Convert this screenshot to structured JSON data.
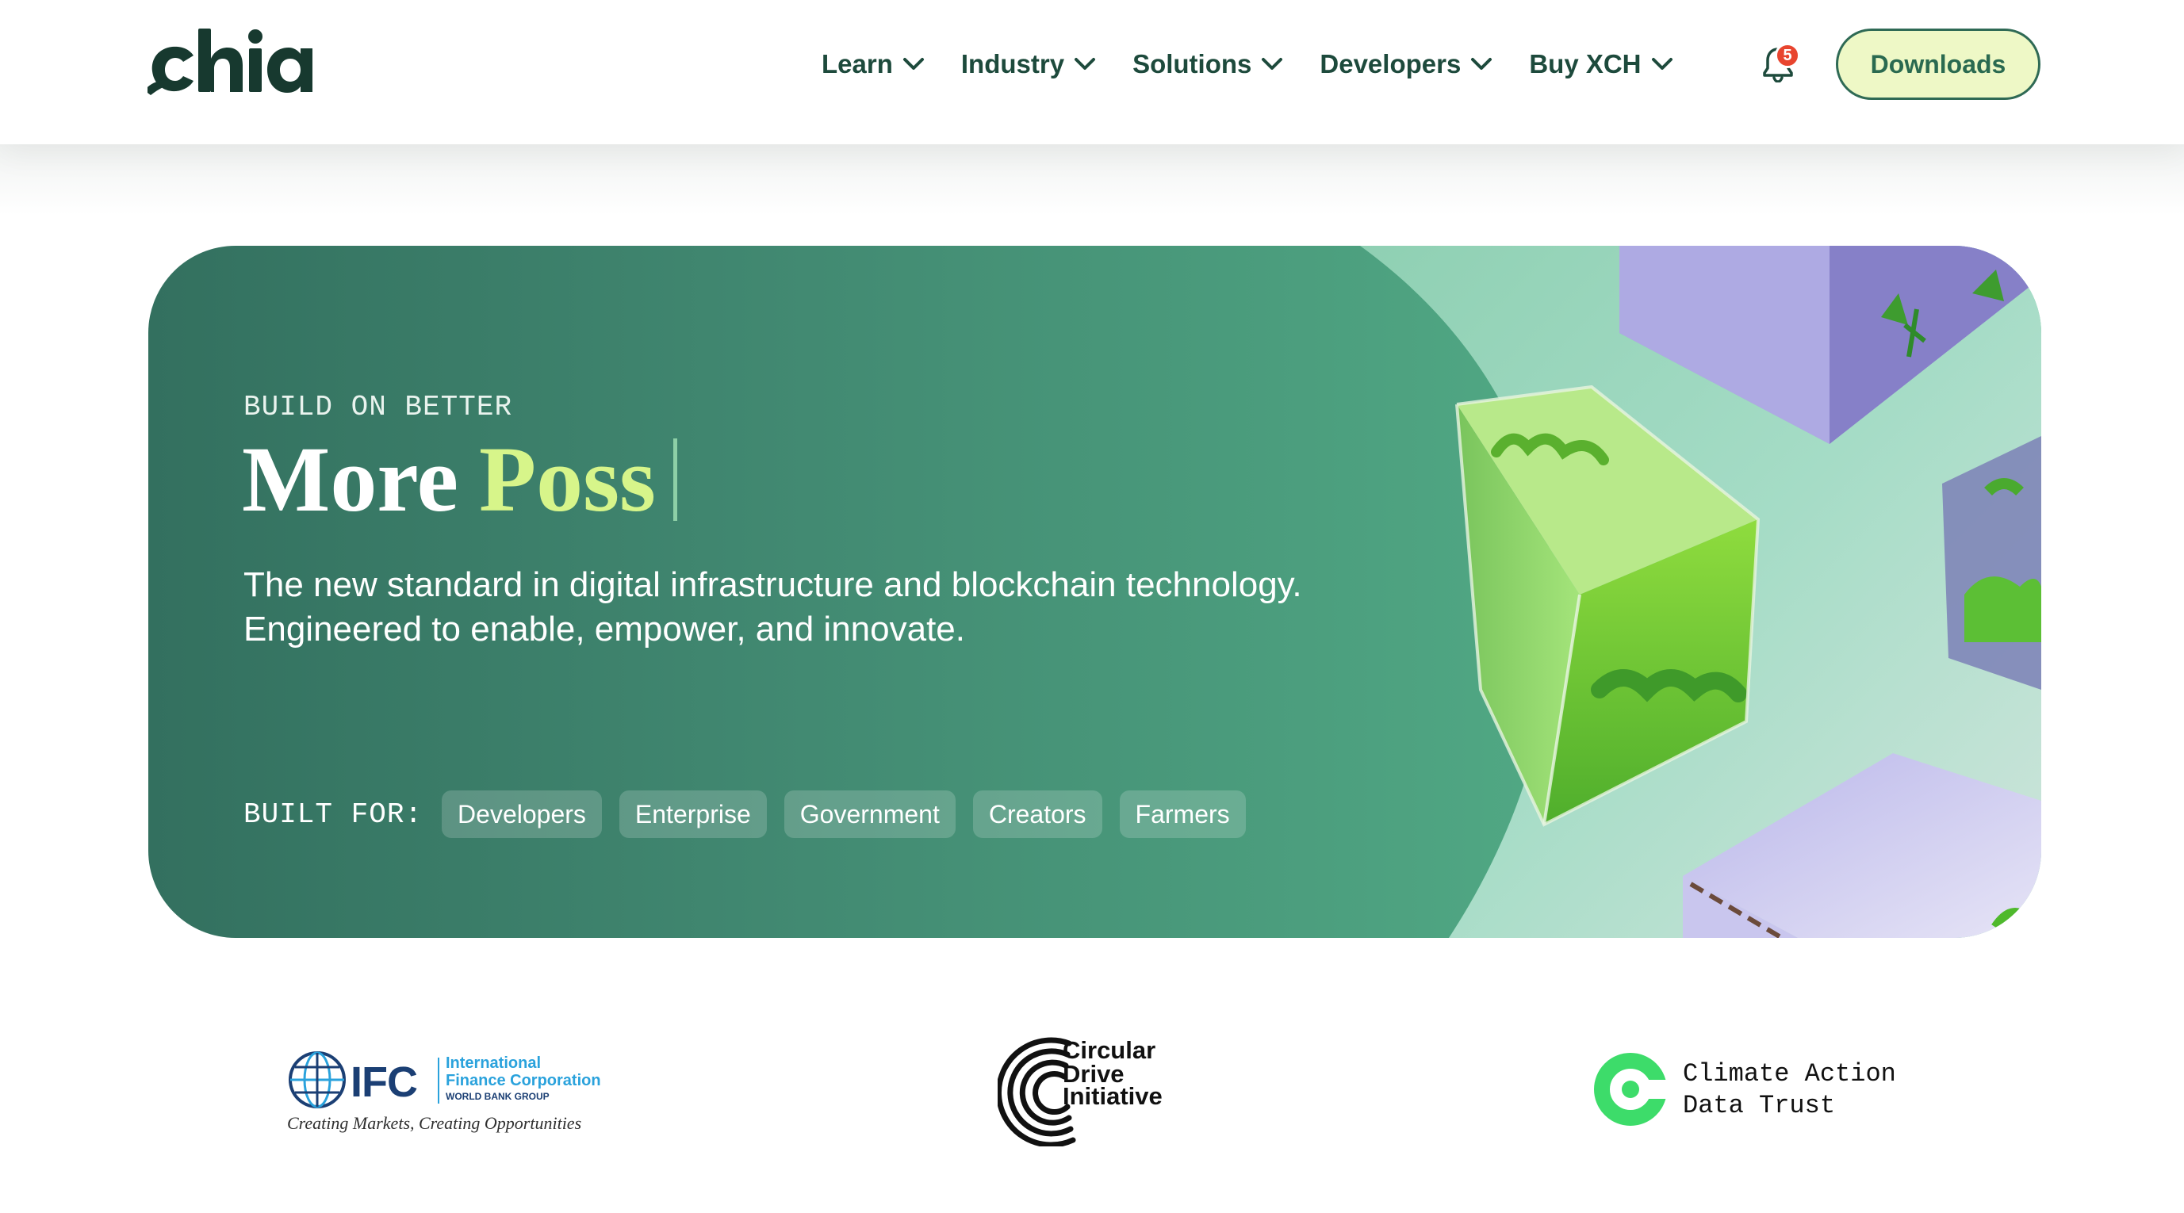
{
  "header": {
    "brand": "chia",
    "nav": [
      {
        "label": "Learn"
      },
      {
        "label": "Industry"
      },
      {
        "label": "Solutions"
      },
      {
        "label": "Developers"
      },
      {
        "label": "Buy XCH"
      }
    ],
    "notification_count": "5",
    "downloads_label": "Downloads"
  },
  "hero": {
    "eyebrow": "BUILD ON BETTER",
    "title_main": "More",
    "title_accent": "Poss",
    "subtitle_line1": "The new standard in digital infrastructure and blockchain technology.",
    "subtitle_line2": "Engineered to enable, empower, and innovate.",
    "built_for_label": "BUILT FOR:",
    "audiences": [
      "Developers",
      "Enterprise",
      "Government",
      "Creators",
      "Farmers"
    ]
  },
  "partners": {
    "ifc": {
      "abbr": "IFC",
      "name_line1": "International",
      "name_line2": "Finance Corporation",
      "name_line3": "WORLD BANK GROUP",
      "tagline": "Creating Markets, Creating Opportunities"
    },
    "cdi": {
      "line1": "Circular",
      "line2": "Drive",
      "line3": "Initiative"
    },
    "cadt": {
      "line1": "Climate Action",
      "line2": "Data Trust"
    }
  },
  "colors": {
    "brand_dark": "#1d4a3c",
    "accent_lime": "#d7f58a",
    "button_bg": "#eef8c6",
    "badge_red": "#e8452f",
    "cadt_green": "#3ddc6a"
  },
  "icons": {
    "nav_chevron": "chevron-down-icon",
    "notifications": "bell-icon",
    "ifc_logo": "globe-icon",
    "cdi_logo": "concentric-arcs-icon",
    "cadt_logo": "ring-logo-icon"
  }
}
